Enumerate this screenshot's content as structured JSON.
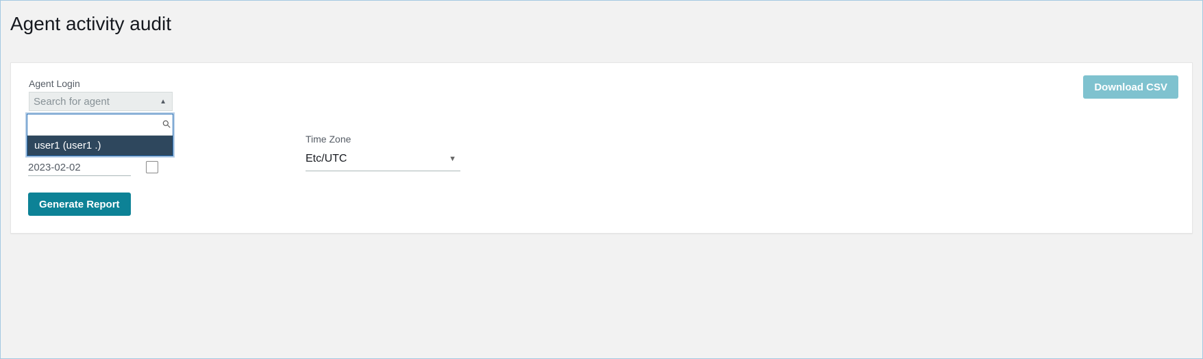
{
  "page": {
    "title": "Agent activity audit"
  },
  "card": {
    "agent_login": {
      "label": "Agent Login",
      "placeholder": "Search for agent",
      "search_value": "",
      "options": [
        "user1 (user1 .)"
      ]
    },
    "date": {
      "value": "2023-02-02"
    },
    "timezone": {
      "label": "Time Zone",
      "value": "Etc/UTC"
    },
    "buttons": {
      "download_csv": "Download CSV",
      "generate": "Generate Report"
    }
  }
}
